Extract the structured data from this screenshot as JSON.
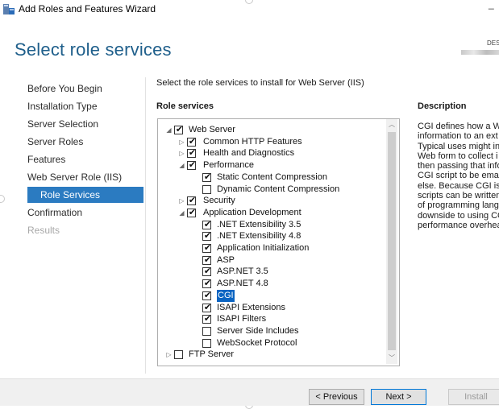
{
  "window": {
    "title": "Add Roles and Features Wizard",
    "minimize_glyph": "_"
  },
  "header": {
    "page_title": "Select role services",
    "server_name": "DES"
  },
  "nav": {
    "items": [
      {
        "label": "Before You Begin",
        "state": "normal"
      },
      {
        "label": "Installation Type",
        "state": "normal"
      },
      {
        "label": "Server Selection",
        "state": "normal"
      },
      {
        "label": "Server Roles",
        "state": "normal"
      },
      {
        "label": "Features",
        "state": "normal"
      },
      {
        "label": "Web Server Role (IIS)",
        "state": "normal"
      },
      {
        "label": "Role Services",
        "state": "selected"
      },
      {
        "label": "Confirmation",
        "state": "normal"
      },
      {
        "label": "Results",
        "state": "disabled"
      }
    ]
  },
  "main": {
    "instruction": "Select the role services to install for Web Server (IIS)",
    "role_services_label": "Role services",
    "description_label": "Description",
    "tree": [
      {
        "label": "Web Server",
        "level": 0,
        "expander": "expanded",
        "checked": true
      },
      {
        "label": "Common HTTP Features",
        "level": 1,
        "expander": "collapsed",
        "checked": true
      },
      {
        "label": "Health and Diagnostics",
        "level": 1,
        "expander": "collapsed",
        "checked": true
      },
      {
        "label": "Performance",
        "level": 1,
        "expander": "expanded",
        "checked": true
      },
      {
        "label": "Static Content Compression",
        "level": 2,
        "expander": "none",
        "checked": true
      },
      {
        "label": "Dynamic Content Compression",
        "level": 2,
        "expander": "none",
        "checked": false
      },
      {
        "label": "Security",
        "level": 1,
        "expander": "collapsed",
        "checked": true
      },
      {
        "label": "Application Development",
        "level": 1,
        "expander": "expanded",
        "checked": true
      },
      {
        "label": ".NET Extensibility 3.5",
        "level": 2,
        "expander": "none",
        "checked": true
      },
      {
        "label": ".NET Extensibility 4.8",
        "level": 2,
        "expander": "none",
        "checked": true
      },
      {
        "label": "Application Initialization",
        "level": 2,
        "expander": "none",
        "checked": true
      },
      {
        "label": "ASP",
        "level": 2,
        "expander": "none",
        "checked": true
      },
      {
        "label": "ASP.NET 3.5",
        "level": 2,
        "expander": "none",
        "checked": true
      },
      {
        "label": "ASP.NET 4.8",
        "level": 2,
        "expander": "none",
        "checked": true
      },
      {
        "label": "CGI",
        "level": 2,
        "expander": "none",
        "checked": true,
        "selected": true
      },
      {
        "label": "ISAPI Extensions",
        "level": 2,
        "expander": "none",
        "checked": true
      },
      {
        "label": "ISAPI Filters",
        "level": 2,
        "expander": "none",
        "checked": true
      },
      {
        "label": "Server Side Includes",
        "level": 2,
        "expander": "none",
        "checked": false
      },
      {
        "label": "WebSocket Protocol",
        "level": 2,
        "expander": "none",
        "checked": false
      },
      {
        "label": "FTP Server",
        "level": 0,
        "expander": "collapsed",
        "checked": false
      }
    ],
    "description_lines": [
      "CGI defines how a W",
      "information to an ext",
      "Typical uses might in",
      "Web form to collect i",
      "then passing that info",
      "CGI script to be emai",
      "else. Because CGI is a",
      "scripts can be written",
      "of programming lang",
      "downside to using CG",
      "performance overhea"
    ]
  },
  "footer": {
    "previous_label": "< Previous",
    "next_label": "Next >",
    "install_label": "Install"
  },
  "colors": {
    "accent": "#2b7bc1",
    "heading": "#1f5f8b",
    "tree_selection": "#0a64c2"
  },
  "icons": {
    "check": "✔",
    "expanded": "◢",
    "collapsed": "▷",
    "scroll_up": "︿",
    "scroll_down": "﹀"
  }
}
